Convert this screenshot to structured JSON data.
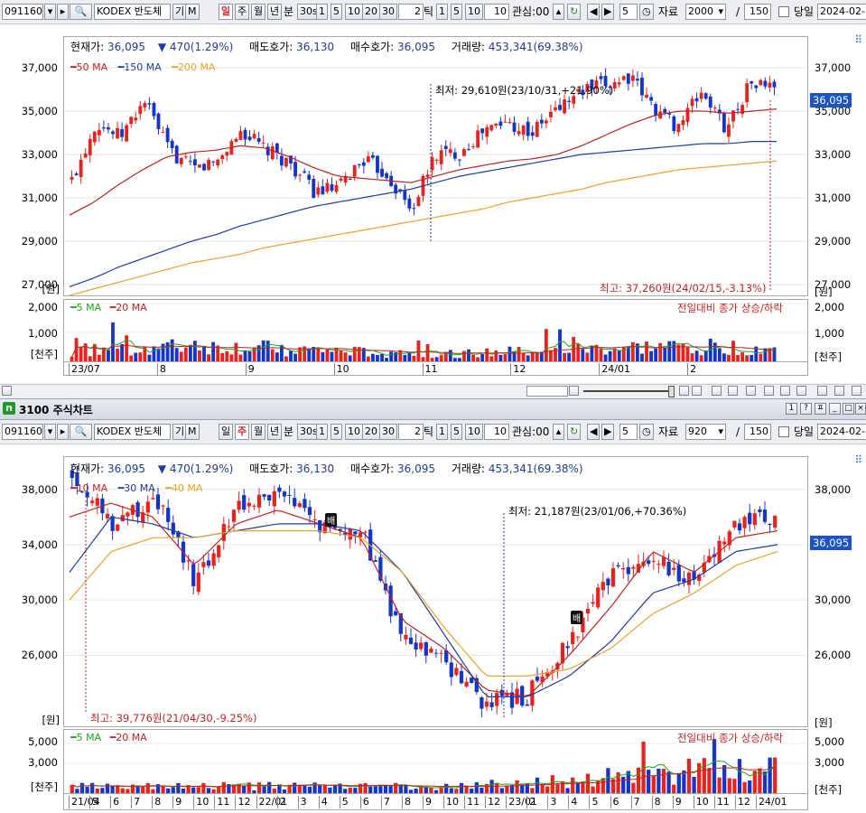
{
  "toolbar": {
    "code": "091160",
    "name": "KODEX 반도체",
    "btn_k": "기",
    "btn_m": "M",
    "periods": [
      "일",
      "주",
      "월",
      "년"
    ],
    "bun": "분",
    "sec30": "30s",
    "mins": [
      "1",
      "5",
      "10",
      "20",
      "30"
    ],
    "tick_value": "2",
    "tick_label": "틱",
    "ticks": [
      "1",
      "5",
      "10"
    ],
    "ticks_value": "10",
    "interest_label": "관심:00",
    "step_value": "5",
    "data_label": "자료",
    "slash": "/",
    "current_label": "당일",
    "date": "2024-02-1"
  },
  "toolbar2": {
    "count": "2000",
    "total": "150"
  },
  "toolbar3": {
    "count": "920",
    "total": "150"
  },
  "window": {
    "num": "n",
    "title": "3100 주식차트",
    "buttons": [
      "1",
      "?",
      "ㅍ",
      "_",
      "□",
      "×"
    ]
  },
  "info": {
    "cur_label": "현재가:",
    "cur_value": "36,095",
    "chg_value": "470(1.29%)",
    "ask_label": "매도호가:",
    "ask_value": "36,130",
    "bid_label": "매수호가:",
    "bid_value": "36,095",
    "vol_label": "거래량:",
    "vol_value": "453,341(69.38%)"
  },
  "unit_won": "[원]",
  "unit_thousand": "[천주]",
  "vol_note": "전일대비 종가 상승/하락",
  "last_price": "36,095",
  "colors": {
    "up": "#e8231e",
    "down": "#1535c8",
    "ma_short": "#c81e1e",
    "ma_mid": "#1c3ca8",
    "ma_long": "#f0a020",
    "vol_ma5": "#18a818",
    "vol_ma20": "#c81e1e"
  },
  "chart1": {
    "legend": [
      "50 MA",
      "150 MA",
      "200 MA"
    ],
    "vol_legend": [
      "5 MA",
      "20 MA"
    ],
    "y_ticks": [
      "37,000",
      "35,000",
      "33,000",
      "31,000",
      "29,000",
      "27,000"
    ],
    "vol_ticks": [
      "2,000",
      "1,000"
    ],
    "months": [
      "23/07",
      "8",
      "9",
      "10",
      "11",
      "12",
      "24/01",
      "2"
    ],
    "low_note": "최저: 29,610원(23/10/31,+21.90%)",
    "high_note": "최고: 37,260원(24/02/15,-3.13%)"
  },
  "chart2": {
    "legend": [
      "10 MA",
      "30 MA",
      "40 MA"
    ],
    "vol_legend": [
      "5 MA",
      "20 MA"
    ],
    "y_ticks": [
      "38,000",
      "34,000",
      "30,000",
      "26,000"
    ],
    "vol_ticks": [
      "5,000",
      "3,000"
    ],
    "months": [
      "21/04",
      "5",
      "6",
      "7",
      "8",
      "9",
      "10",
      "11",
      "12",
      "22/01",
      "2",
      "3",
      "4",
      "5",
      "6",
      "7",
      "8",
      "9",
      "10",
      "11",
      "12",
      "23/01",
      "2",
      "3",
      "4",
      "5",
      "6",
      "7",
      "8",
      "9",
      "10",
      "11",
      "12",
      "24/01"
    ],
    "low_note": "최저: 21,187원(23/01/06,+70.36%)",
    "high_note": "최고: 39,776원(21/04/30,-9.25%)",
    "marker": "배"
  },
  "chart_data": [
    {
      "type": "candlestick",
      "title": "",
      "period": "daily",
      "y_range": [
        26500,
        38000
      ],
      "x": [
        "23/07",
        "23/07",
        "23/07",
        "23/07",
        "23/08",
        "23/08",
        "23/08",
        "23/08",
        "23/09",
        "23/09",
        "23/09",
        "23/09",
        "23/10",
        "23/10",
        "23/10",
        "23/10",
        "23/11",
        "23/11",
        "23/11",
        "23/11",
        "23/12",
        "23/12",
        "23/12",
        "23/12",
        "24/01",
        "24/01",
        "24/01",
        "24/01",
        "24/02",
        "24/02"
      ],
      "close": [
        31800,
        34500,
        33800,
        35500,
        33200,
        32300,
        32700,
        34100,
        33200,
        32600,
        31300,
        31400,
        32800,
        32100,
        30400,
        33000,
        33100,
        34100,
        34500,
        34000,
        35100,
        35900,
        36200,
        36600,
        35200,
        34300,
        35900,
        34200,
        36300,
        36095
      ],
      "ma": {
        "50 MA": [
          30200,
          30800,
          31600,
          32300,
          32900,
          33100,
          33200,
          33400,
          33300,
          32900,
          32400,
          32000,
          31900,
          31800,
          31700,
          32000,
          32300,
          32500,
          32700,
          32800,
          33000,
          33400,
          33900,
          34400,
          34800,
          35000,
          35000,
          34900,
          35000,
          35100
        ],
        "150 MA": [
          26900,
          27300,
          27800,
          28200,
          28600,
          29000,
          29300,
          29700,
          30000,
          30300,
          30600,
          30800,
          31000,
          31200,
          31400,
          31700,
          32000,
          32200,
          32400,
          32600,
          32800,
          33000,
          33100,
          33200,
          33300,
          33400,
          33500,
          33500,
          33600,
          33600
        ],
        "200 MA": [
          26500,
          26800,
          27100,
          27400,
          27700,
          28000,
          28200,
          28400,
          28700,
          28900,
          29100,
          29300,
          29500,
          29700,
          29900,
          30100,
          30300,
          30500,
          30800,
          31000,
          31200,
          31400,
          31700,
          31900,
          32100,
          32300,
          32400,
          32500,
          32600,
          32700
        ]
      },
      "volume_range": [
        0,
        2000
      ]
    },
    {
      "type": "candlestick",
      "title": "",
      "period": "weekly",
      "y_range": [
        21000,
        40000
      ],
      "x": [
        "21/04",
        "21/06",
        "21/08",
        "21/10",
        "21/12",
        "22/02",
        "22/04",
        "22/06",
        "22/08",
        "22/10",
        "22/12",
        "23/02",
        "23/04",
        "23/06",
        "23/08",
        "23/10",
        "23/12",
        "24/01"
      ],
      "close": [
        39000,
        35500,
        37500,
        31000,
        37000,
        37500,
        35500,
        35000,
        27000,
        25500,
        22500,
        23000,
        27000,
        31500,
        33000,
        31500,
        35500,
        36095
      ],
      "ma": {
        "10 MA": [
          36000,
          37000,
          36000,
          32500,
          35500,
          36500,
          35500,
          34500,
          28500,
          26500,
          23500,
          23000,
          26000,
          29500,
          33500,
          32000,
          34500,
          35000
        ],
        "30 MA": [
          32000,
          36000,
          35500,
          34500,
          35000,
          35500,
          35500,
          35000,
          32000,
          27500,
          23000,
          23000,
          24500,
          27000,
          30500,
          31500,
          33500,
          34000
        ],
        "40 MA": [
          30000,
          33500,
          34500,
          34500,
          35000,
          35000,
          35000,
          34500,
          32000,
          28000,
          24500,
          24500,
          25000,
          26500,
          29000,
          30500,
          32500,
          33500
        ]
      },
      "volume_range": [
        0,
        6000
      ]
    }
  ]
}
